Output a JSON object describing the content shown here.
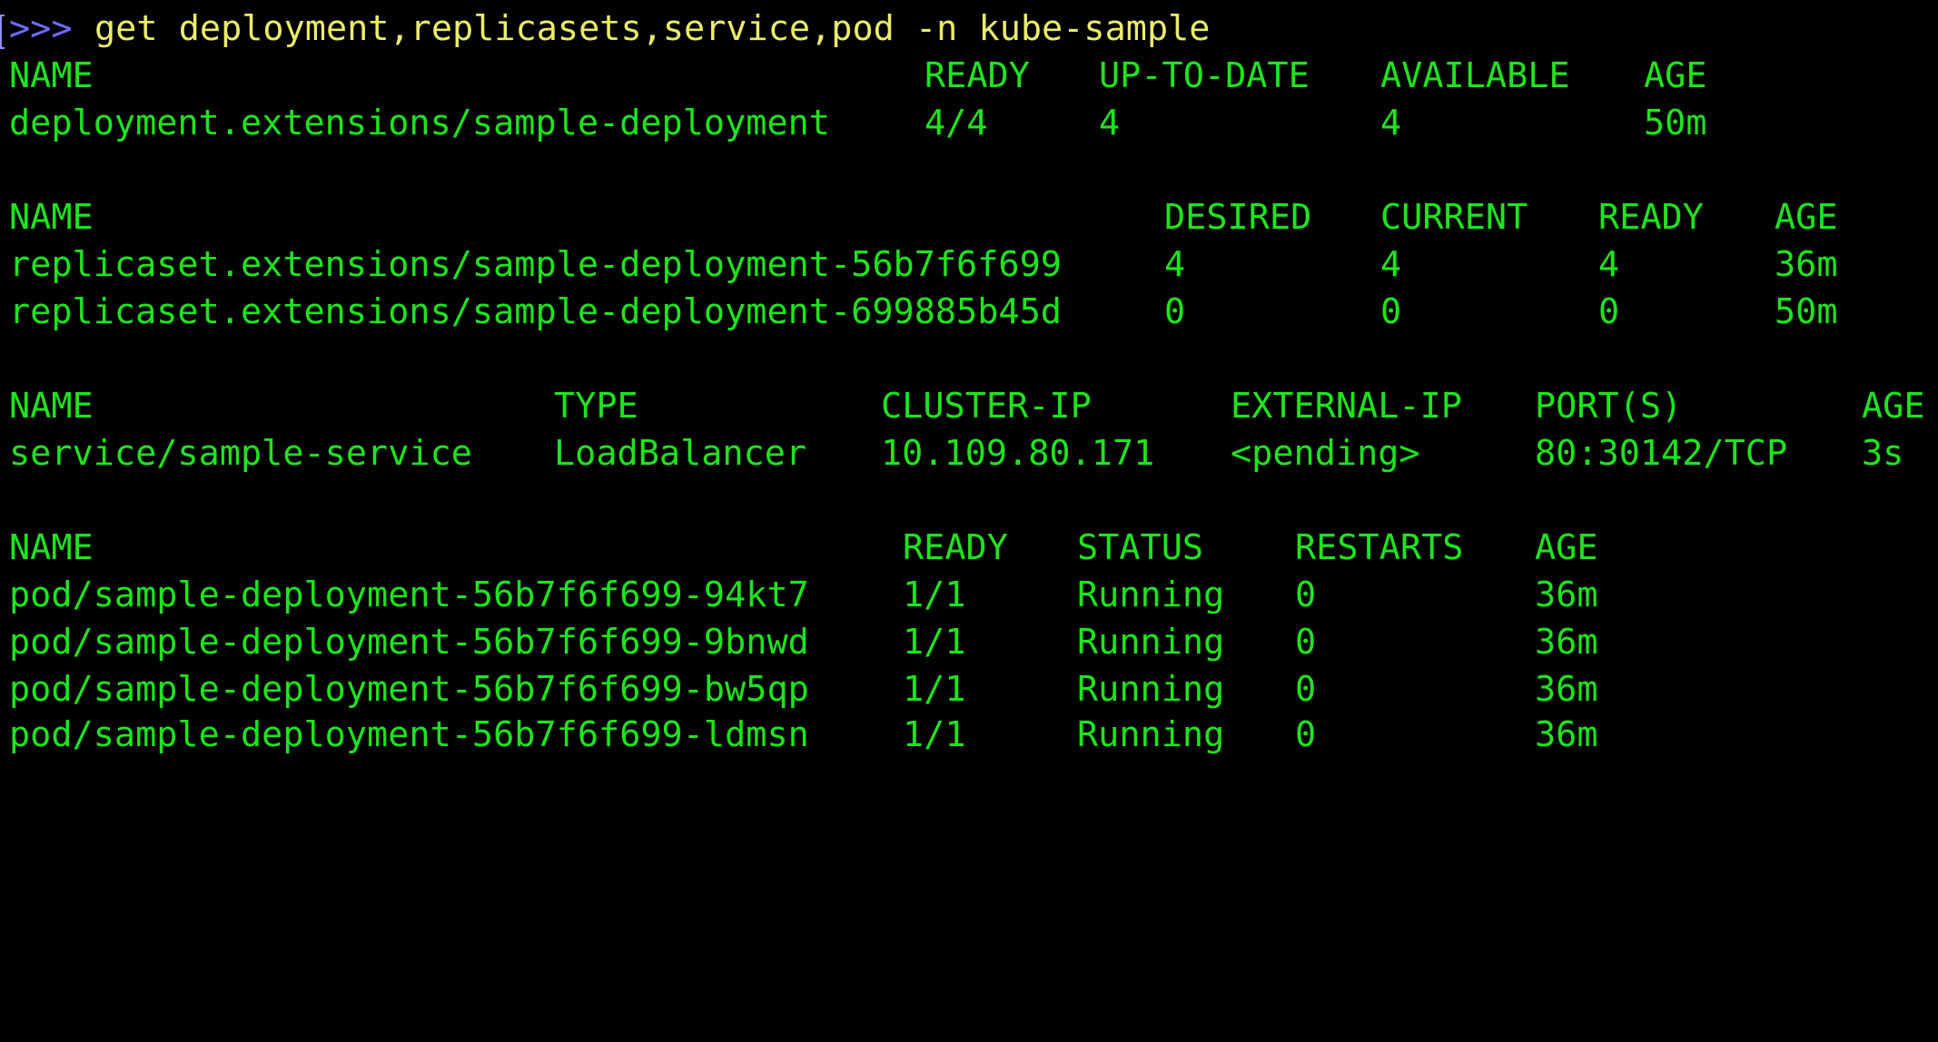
{
  "prompt": {
    "symbol": ">>>",
    "command": "get deployment,replicasets,service,pod -n kube-sample"
  },
  "deployment": {
    "headers": [
      "NAME",
      "READY",
      "UP-TO-DATE",
      "AVAILABLE",
      "AGE"
    ],
    "rows": [
      [
        "deployment.extensions/sample-deployment",
        "4/4",
        "4",
        "4",
        "50m"
      ]
    ]
  },
  "replicasets": {
    "headers": [
      "NAME",
      "DESIRED",
      "CURRENT",
      "READY",
      "AGE"
    ],
    "rows": [
      [
        "replicaset.extensions/sample-deployment-56b7f6f699",
        "4",
        "4",
        "4",
        "36m"
      ],
      [
        "replicaset.extensions/sample-deployment-699885b45d",
        "0",
        "0",
        "0",
        "50m"
      ]
    ]
  },
  "service": {
    "headers": [
      "NAME",
      "TYPE",
      "CLUSTER-IP",
      "EXTERNAL-IP",
      "PORT(S)",
      "AGE"
    ],
    "rows": [
      [
        "service/sample-service",
        "LoadBalancer",
        "10.109.80.171",
        "<pending>",
        "80:30142/TCP",
        "3s"
      ]
    ]
  },
  "pods": {
    "headers": [
      "NAME",
      "READY",
      "STATUS",
      "RESTARTS",
      "AGE"
    ],
    "rows": [
      [
        "pod/sample-deployment-56b7f6f699-94kt7",
        "1/1",
        "Running",
        "0",
        "36m"
      ],
      [
        "pod/sample-deployment-56b7f6f699-9bnwd",
        "1/1",
        "Running",
        "0",
        "36m"
      ],
      [
        "pod/sample-deployment-56b7f6f699-bw5qp",
        "1/1",
        "Running",
        "0",
        "36m"
      ],
      [
        "pod/sample-deployment-56b7f6f699-ldmsn",
        "1/1",
        "Running",
        "0",
        "36m"
      ]
    ]
  },
  "colors": {
    "background": "#000000",
    "output_text": "#1ee41e",
    "prompt_symbol": "#6c6cff",
    "command_text": "#ecec6a"
  }
}
